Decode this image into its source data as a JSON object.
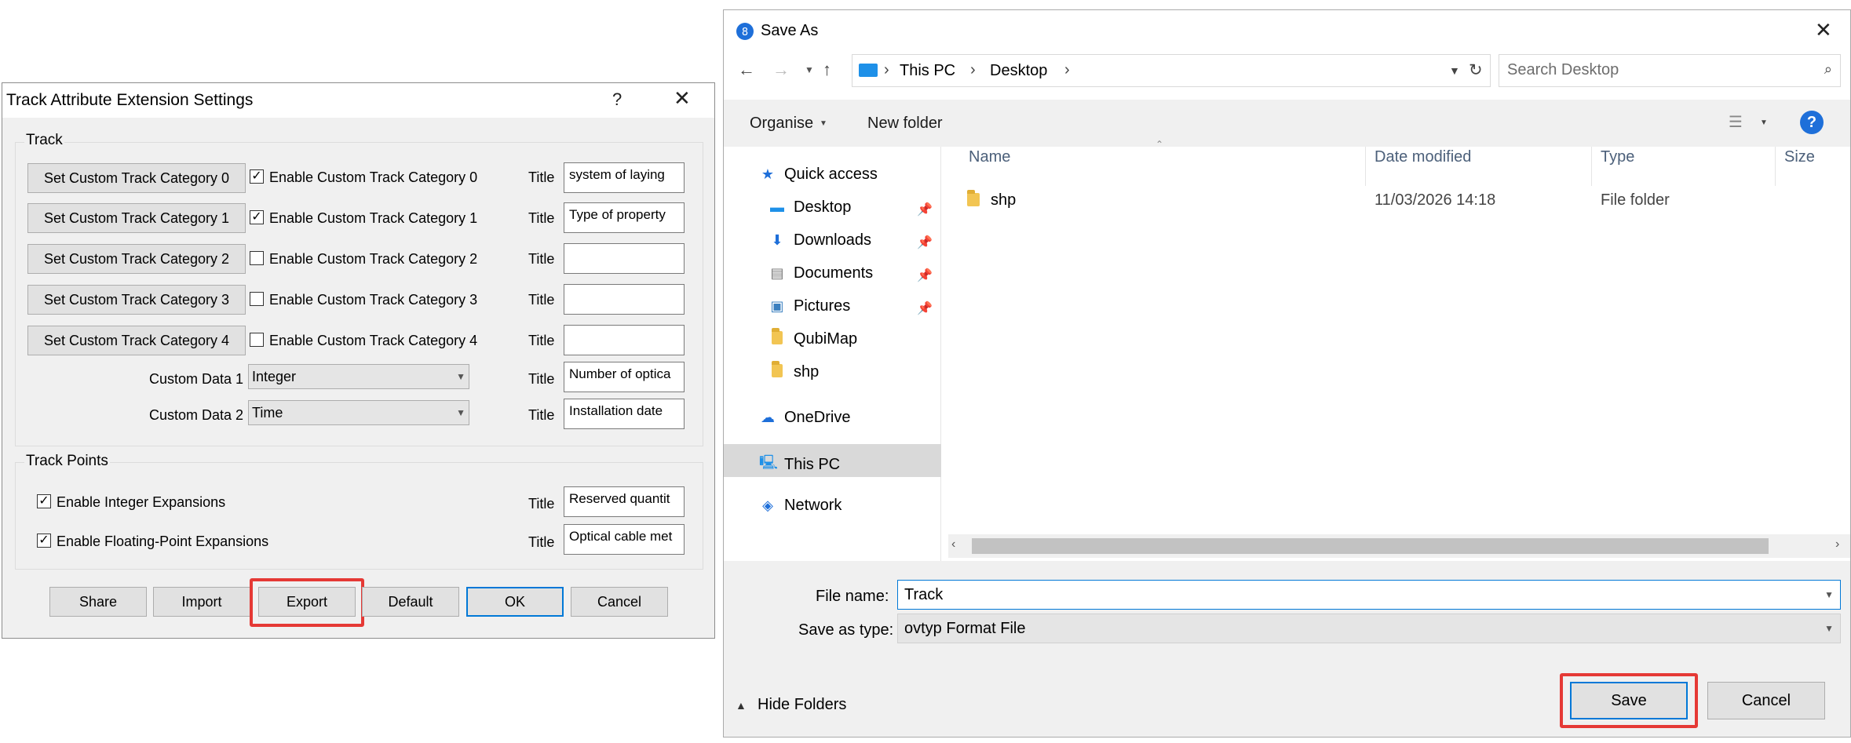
{
  "track_dialog": {
    "title": "Track Attribute Extension Settings",
    "help_glyph": "?",
    "close_glyph": "✕",
    "track_group_label": "Track",
    "categories": [
      {
        "button": "Set Custom Track Category 0",
        "checkbox_label": "Enable Custom Track Category 0",
        "checked": true,
        "title_label": "Title",
        "title_value": "system of laying"
      },
      {
        "button": "Set Custom Track Category 1",
        "checkbox_label": "Enable Custom Track Category 1",
        "checked": true,
        "title_label": "Title",
        "title_value": "Type of property"
      },
      {
        "button": "Set Custom Track Category 2",
        "checkbox_label": "Enable Custom Track Category 2",
        "checked": false,
        "title_label": "Title",
        "title_value": ""
      },
      {
        "button": "Set Custom Track Category 3",
        "checkbox_label": "Enable Custom Track Category 3",
        "checked": false,
        "title_label": "Title",
        "title_value": ""
      },
      {
        "button": "Set Custom Track Category 4",
        "checkbox_label": "Enable Custom Track Category 4",
        "checked": false,
        "title_label": "Title",
        "title_value": ""
      }
    ],
    "custom_data": [
      {
        "label": "Custom Data 1",
        "value": "Integer",
        "title_label": "Title",
        "title_value": "Number of optica"
      },
      {
        "label": "Custom Data 2",
        "value": "Time",
        "title_label": "Title",
        "title_value": "Installation date"
      }
    ],
    "track_points_group_label": "Track Points",
    "expansions": [
      {
        "label": "Enable Integer Expansions",
        "checked": true,
        "title_label": "Title",
        "title_value": "Reserved quantit"
      },
      {
        "label": "Enable Floating-Point Expansions",
        "checked": true,
        "title_label": "Title",
        "title_value": "Optical cable met"
      }
    ],
    "buttons": {
      "share": "Share",
      "import": "Import",
      "export": "Export",
      "default": "Default",
      "ok": "OK",
      "cancel": "Cancel"
    }
  },
  "save_dialog": {
    "title": "Save As",
    "close_glyph": "✕",
    "breadcrumb": [
      "This PC",
      "Desktop"
    ],
    "search_placeholder": "Search Desktop",
    "organise": "Organise",
    "new_folder": "New folder",
    "help_glyph": "?",
    "nav": [
      {
        "label": "Quick access",
        "icon": "star-icon",
        "pinned": false
      },
      {
        "label": "Desktop",
        "icon": "desktop-icon",
        "pinned": true
      },
      {
        "label": "Downloads",
        "icon": "download-icon",
        "pinned": true
      },
      {
        "label": "Documents",
        "icon": "document-icon",
        "pinned": true
      },
      {
        "label": "Pictures",
        "icon": "picture-icon",
        "pinned": true
      },
      {
        "label": "QubiMap",
        "icon": "folder-icon",
        "pinned": false
      },
      {
        "label": "shp",
        "icon": "folder-icon",
        "pinned": false
      },
      {
        "label": "OneDrive",
        "icon": "cloud-icon",
        "pinned": false
      },
      {
        "label": "This PC",
        "icon": "computer-icon",
        "pinned": false
      },
      {
        "label": "Network",
        "icon": "network-icon",
        "pinned": false
      }
    ],
    "columns": [
      "Name",
      "Date modified",
      "Type",
      "Size"
    ],
    "files": [
      {
        "name": "shp",
        "date": "11/03/2026 14:18",
        "type": "File folder",
        "size": ""
      }
    ],
    "file_name_label": "File name:",
    "file_name_value": "Track",
    "save_type_label": "Save as type:",
    "save_type_value": "ovtyp Format File",
    "hide_folders": "Hide Folders",
    "save_button": "Save",
    "cancel_button": "Cancel"
  },
  "colors": {
    "accent": "#0078d7",
    "highlight_frame": "#e53935",
    "dialog_bg": "#f0f0f0"
  }
}
